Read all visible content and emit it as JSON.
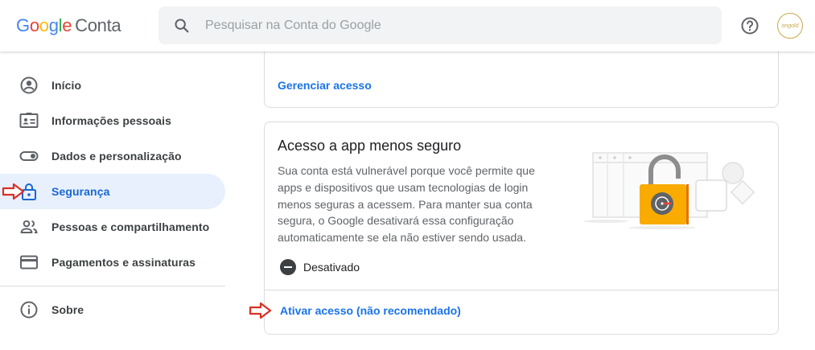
{
  "header": {
    "logo_google_letters": [
      "G",
      "o",
      "o",
      "g",
      "l",
      "e"
    ],
    "logo_product": "Conta",
    "search_placeholder": "Pesquisar na Conta do Google",
    "avatar_text": "ongold",
    "icons": {
      "search": "search-icon",
      "help": "help-icon"
    }
  },
  "sidebar": {
    "items": [
      {
        "label": "Início",
        "icon": "account-circle-icon",
        "active": false
      },
      {
        "label": "Informações pessoais",
        "icon": "id-card-icon",
        "active": false
      },
      {
        "label": "Dados e personalização",
        "icon": "toggle-icon",
        "active": false
      },
      {
        "label": "Segurança",
        "icon": "lock-icon",
        "active": true
      },
      {
        "label": "Pessoas e compartilhamento",
        "icon": "people-icon",
        "active": false
      },
      {
        "label": "Pagamentos e assinaturas",
        "icon": "credit-card-icon",
        "active": false
      }
    ],
    "footer_item": {
      "label": "Sobre",
      "icon": "info-icon"
    }
  },
  "main": {
    "card_access": {
      "link": "Gerenciar acesso"
    },
    "card_less_secure": {
      "title": "Acesso a app menos seguro",
      "description": "Sua conta está vulnerável porque você permite que apps e dispositivos que usam tecnologias de login menos seguras a acessem. Para manter sua conta segura, o Google desativará essa configuração automaticamente se ela não estiver sendo usada.",
      "status": "Desativado",
      "action_link": "Ativar acesso (não recomendado)"
    }
  },
  "colors": {
    "accent_blue": "#1a73e8",
    "active_nav_bg": "#e8f0fe",
    "annotation_arrow": "#d93025",
    "lock_orange": "#f9ab00"
  }
}
